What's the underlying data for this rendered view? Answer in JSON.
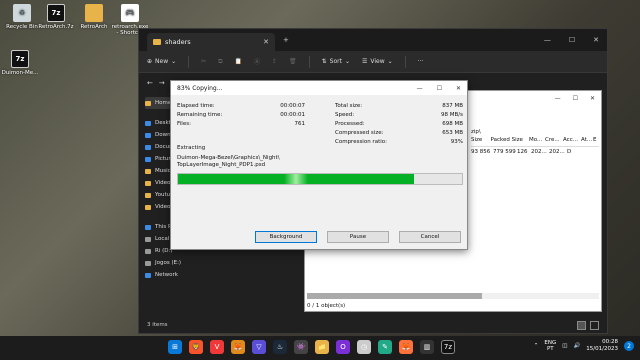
{
  "desktop": {
    "icons": [
      {
        "label": "Recycle Bin",
        "glyph": "♻"
      },
      {
        "label": "RetroArch.7z",
        "glyph": "7z"
      },
      {
        "label": "RetroArch",
        "glyph": ""
      },
      {
        "label": "retroarch.exe - Shortcut",
        "glyph": "🎮"
      },
      {
        "label": "Duimon-Me...",
        "glyph": "7z"
      }
    ]
  },
  "explorer": {
    "tab_title": "shaders",
    "toolbar": {
      "new_label": "New",
      "sort_label": "Sort",
      "view_label": "View",
      "more_label": "···"
    },
    "sidebar": [
      {
        "label": "Home",
        "icon": "home-icon"
      },
      {
        "label": "Desktop",
        "icon": "desktop-icon"
      },
      {
        "label": "Downloads",
        "icon": "downloads-icon"
      },
      {
        "label": "Documents",
        "icon": "documents-icon"
      },
      {
        "label": "Pictures",
        "icon": "pictures-icon"
      },
      {
        "label": "Music",
        "icon": "music-icon"
      },
      {
        "label": "Videos",
        "icon": "videos-icon"
      },
      {
        "label": "Youtube",
        "icon": "folder-icon"
      },
      {
        "label": "Videos",
        "icon": "folder-icon"
      },
      {
        "label": "This PC",
        "icon": "this-pc-icon"
      },
      {
        "label": "Local Disk (C:)",
        "icon": "drive-icon"
      },
      {
        "label": "Ri (D:)",
        "icon": "drive-icon"
      },
      {
        "label": "Jogos (E:)",
        "icon": "drive-icon"
      },
      {
        "label": "Network",
        "icon": "network-icon"
      }
    ],
    "status": "3 items"
  },
  "zip": {
    "path": "zip\\",
    "headers": [
      "Size",
      "Packed Size",
      "Mo...",
      "Cre...",
      "Acc...",
      "At...",
      "E"
    ],
    "row": [
      "93 856",
      "779 599",
      "126",
      "202...",
      "202...",
      "D",
      ""
    ],
    "status": "0 / 1 object(s)"
  },
  "dialog": {
    "title": "83% Copying...",
    "progress": 0.83,
    "left": [
      {
        "label": "Elapsed time:",
        "value": "00:00:07"
      },
      {
        "label": "Remaining time:",
        "value": "00:00:01"
      },
      {
        "label": "Files:",
        "value": "761"
      }
    ],
    "right": [
      {
        "label": "Total size:",
        "value": "837 MB"
      },
      {
        "label": "Speed:",
        "value": "98 MB/s"
      },
      {
        "label": "Processed:",
        "value": "698 MB"
      },
      {
        "label": "Compressed size:",
        "value": "653 MB"
      },
      {
        "label": "Compression ratio:",
        "value": "93%"
      }
    ],
    "extracting_label": "Extracting",
    "file_line1": "Duimon-Mega-Bezel\\Graphics\\_Night\\",
    "file_line2": "TopLayerImage_Night_PDP1.psd",
    "buttons": {
      "background": "Background",
      "pause": "Pause",
      "cancel": "Cancel"
    }
  },
  "taskbar": {
    "lang_top": "ENG",
    "lang_bottom": "PT",
    "time": "00:28",
    "date": "15/01/2023",
    "notifications": "2"
  }
}
